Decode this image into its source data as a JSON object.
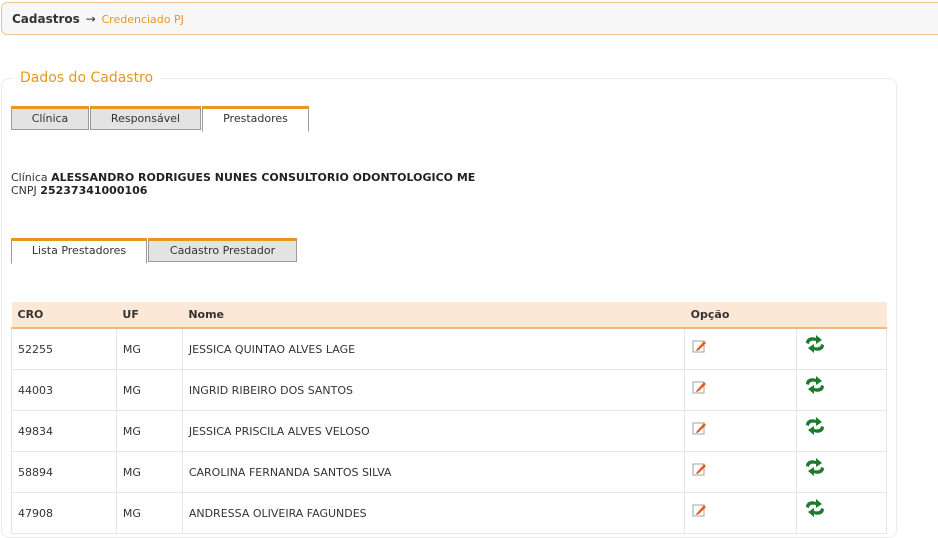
{
  "breadcrumb": {
    "root": "Cadastros",
    "arrow": "→",
    "current": "Credenciado PJ"
  },
  "panel": {
    "legend": "Dados do Cadastro"
  },
  "tabs_top": [
    {
      "label": "Clínica",
      "active": false
    },
    {
      "label": "Responsável",
      "active": false
    },
    {
      "label": "Prestadores",
      "active": true
    }
  ],
  "clinic": {
    "clinic_label": "Clínica",
    "clinic_name": "ALESSANDRO RODRIGUES NUNES CONSULTORIO ODONTOLOGICO ME",
    "cnpj_label": "CNPJ",
    "cnpj_value": "25237341000106"
  },
  "tabs_sub": [
    {
      "label": "Lista Prestadores",
      "active": true
    },
    {
      "label": "Cadastro Prestador",
      "active": false
    }
  ],
  "table": {
    "headers": {
      "cro": "CRO",
      "uf": "UF",
      "nome": "Nome",
      "opcao": "Opção"
    },
    "rows": [
      {
        "cro": "52255",
        "uf": "MG",
        "nome": "JESSICA QUINTAO ALVES LAGE"
      },
      {
        "cro": "44003",
        "uf": "MG",
        "nome": "INGRID RIBEIRO DOS SANTOS"
      },
      {
        "cro": "49834",
        "uf": "MG",
        "nome": "JESSICA PRISCILA ALVES VELOSO"
      },
      {
        "cro": "58894",
        "uf": "MG",
        "nome": "CAROLINA FERNANDA SANTOS SILVA"
      },
      {
        "cro": "47908",
        "uf": "MG",
        "nome": "ANDRESSA OLIVEIRA FAGUNDES"
      }
    ],
    "row_icons": {
      "edit": "edit-pencil-icon",
      "swap": "swap-arrows-icon"
    }
  },
  "colors": {
    "accent": "#e8961e",
    "header_bg": "#fbe8d6",
    "icon_green": "#1e7a2e"
  }
}
